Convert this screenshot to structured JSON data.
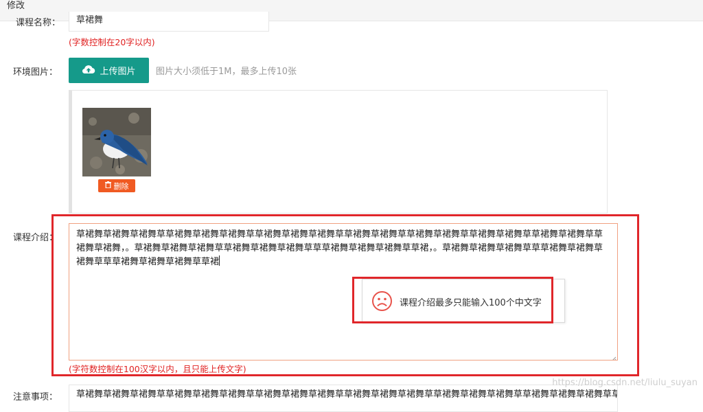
{
  "topbar": {
    "title": "修改"
  },
  "course_name": {
    "label": "课程名称：",
    "value": "草裙舞",
    "hint": "(字数控制在20字以内)"
  },
  "env_images": {
    "label": "环境图片：",
    "upload_label": "上传图片",
    "hint": "图片大小须低于1M，最多上传10张",
    "delete_label": "删除"
  },
  "course_intro": {
    "label": "课程介绍：",
    "value": "草裙舞草裙舞草裙舞草草裙舞草裙舞草裙舞草草裙舞草裙舞草裙舞草草裙舞草裙舞草草裙舞草裙舞草草裙舞草裙舞草草裙舞草裙舞草草裙舞草裙舞，。草裙舞草裙舞草裙舞草草裙舞草裙舞草裙舞草草草裙舞草裙舞草裙舞草草裙，。草裙舞草裙舞草裙舞草草草裙舞草裙舞草裙舞草草草裙舞草裙舞草裙舞草草裙",
    "hint": "(字符数控制在100汉字以内，且只能上传文字)"
  },
  "toast": {
    "message": "课程介绍最多只能输入100个中文字",
    "icon": "sad-face-icon",
    "color": "#e8524a"
  },
  "notes": {
    "label": "注意事项：",
    "value": "草裙舞草裙舞草裙舞草草裙舞草裙舞草裙舞草草裙舞草裙舞草裙舞草草裙舞草裙舞草裙舞草草裙舞草裙舞草裙舞草草裙舞草裙舞草裙舞草草裙"
  },
  "watermark": "https://blog.csdn.net/liulu_suyan",
  "colors": {
    "accent": "#159a8a",
    "danger": "#f05a22",
    "error": "#e02020",
    "highlight": "#e0262a"
  }
}
